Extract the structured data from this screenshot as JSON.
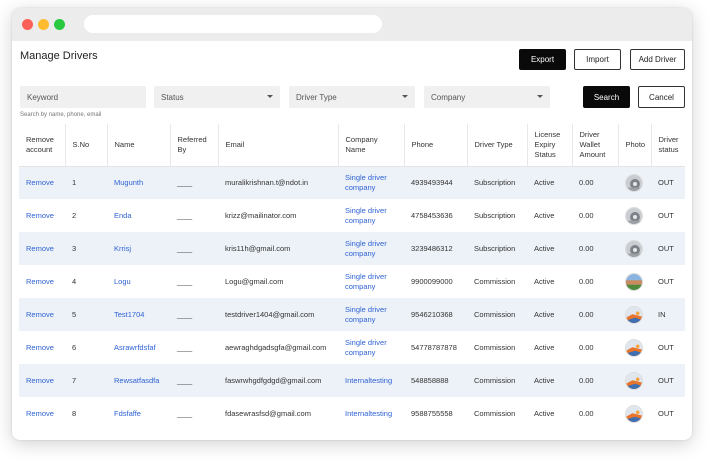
{
  "page": {
    "title": "Manage Drivers",
    "export_label": "Export",
    "import_label": "Import",
    "add_driver_label": "Add Driver",
    "search_label": "Search",
    "cancel_label": "Cancel",
    "hint": "Search by name, phone, email"
  },
  "filters": {
    "keyword_placeholder": "Keyword",
    "status_label": "Status",
    "driver_type_label": "Driver Type",
    "company_label": "Company"
  },
  "table": {
    "headers": [
      "Remove account",
      "S.No",
      "Name",
      "Referred By",
      "Email",
      "Company Name",
      "Phone",
      "Driver Type",
      "License Expiry Status",
      "Driver Wallet Amount",
      "Photo",
      "Driver status"
    ],
    "rows": [
      {
        "remove": "Remove",
        "sno": "1",
        "name": "Mugunth",
        "referred": "____",
        "email": "muralikrishnan.t@ndot.in",
        "company": "Single driver company",
        "phone": "4939493944",
        "type": "Subscription",
        "license": "Active",
        "wallet": "0.00",
        "photo": "gear-avatar",
        "status": "OUT"
      },
      {
        "remove": "Remove",
        "sno": "2",
        "name": "Enda",
        "referred": "____",
        "email": "krizz@mailinator.com",
        "company": "Single driver company",
        "phone": "4758453636",
        "type": "Subscription",
        "license": "Active",
        "wallet": "0.00",
        "photo": "gear-avatar",
        "status": "OUT"
      },
      {
        "remove": "Remove",
        "sno": "3",
        "name": "Krrisj",
        "referred": "____",
        "email": "kris11h@gmail.com",
        "company": "Single driver company",
        "phone": "3239486312",
        "type": "Subscription",
        "license": "Active",
        "wallet": "0.00",
        "photo": "gear-avatar",
        "status": "OUT"
      },
      {
        "remove": "Remove",
        "sno": "4",
        "name": "Logu",
        "referred": "____",
        "email": "Logu@gmail.com",
        "company": "Single driver company",
        "phone": "9900099000",
        "type": "Commission",
        "license": "Active",
        "wallet": "0.00",
        "photo": "landscape-avatar",
        "status": "OUT"
      },
      {
        "remove": "Remove",
        "sno": "5",
        "name": "Test1704",
        "referred": "____",
        "email": "testdriver1404@gmail.com",
        "company": "Single driver company",
        "phone": "9546210368",
        "type": "Commission",
        "license": "Active",
        "wallet": "0.00",
        "photo": "sunset-avatar",
        "status": "IN"
      },
      {
        "remove": "Remove",
        "sno": "6",
        "name": "Asrawrfdsfaf",
        "referred": "____",
        "email": "aewraghdgadsgfa@gmail.com",
        "company": "Single driver company",
        "phone": "54778787878",
        "type": "Commission",
        "license": "Active",
        "wallet": "0.00",
        "photo": "sunset-avatar",
        "status": "OUT"
      },
      {
        "remove": "Remove",
        "sno": "7",
        "name": "Rewsatfasdfa",
        "referred": "____",
        "email": "faswrwhgdfgdgd@gmail.com",
        "company": "Internaltesting",
        "phone": "548858888",
        "type": "Commission",
        "license": "Active",
        "wallet": "0.00",
        "photo": "sunset-avatar",
        "status": "OUT"
      },
      {
        "remove": "Remove",
        "sno": "8",
        "name": "Fdsfaffe",
        "referred": "____",
        "email": "fdasewrasfsd@gmail.com",
        "company": "Internaltesting",
        "phone": "9588755558",
        "type": "Commission",
        "license": "Active",
        "wallet": "0.00",
        "photo": "sunset-avatar",
        "status": "OUT"
      }
    ]
  },
  "colors": {
    "link": "#2f62d4",
    "row_stripe": "#edf2f8",
    "primary_button": "#0a0a0a"
  }
}
